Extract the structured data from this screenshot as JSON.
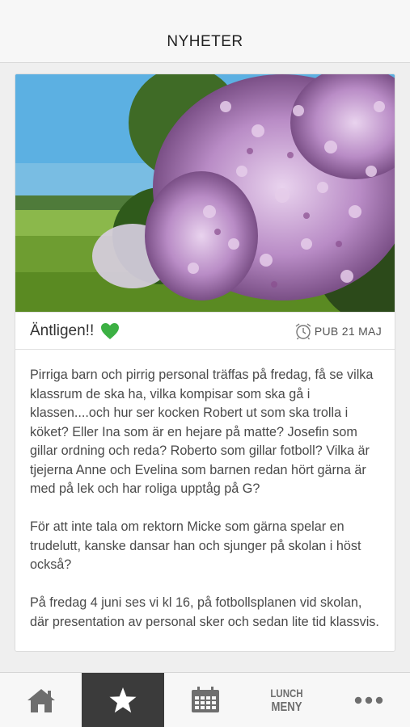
{
  "header": {
    "title": "NYHETER"
  },
  "post": {
    "title": "Äntligen!!",
    "title_icon": "green-heart-icon",
    "pub_label": "PUB 21 MAJ",
    "paragraphs": [
      "Pirriga barn och pirrig personal träffas på fredag, få se vilka klassrum de ska ha, vilka kompisar som ska gå i klassen....och hur ser kocken Robert ut som ska trolla i köket? Eller Ina som är en hejare på matte? Josefin som gillar ordning och reda? Roberto som gillar fotboll? Vilka är tjejerna Anne och Evelina som barnen redan hört gärna är med på lek och har roliga upptåg på G?",
      "För att inte tala om rektorn Micke som gärna spelar en trudelutt, kanske dansar han och sjunger på skolan i höst också?",
      "På fredag 4 juni ses vi kl 16, på fotbollsplanen vid skolan, där presentation av personal sker och sedan lite tid klassvis."
    ]
  },
  "tabbar": {
    "tabs": [
      {
        "name": "home",
        "icon": "home-icon"
      },
      {
        "name": "news",
        "icon": "star-icon",
        "active": true
      },
      {
        "name": "calendar",
        "icon": "calendar-icon"
      },
      {
        "name": "lunch",
        "line1": "LUNCH",
        "line2": "MENY"
      },
      {
        "name": "more",
        "icon": "more-icon"
      }
    ]
  },
  "colors": {
    "active_tab": "#3b3b3b",
    "heart": "#3cb043",
    "lilac": "#b58bc2"
  }
}
